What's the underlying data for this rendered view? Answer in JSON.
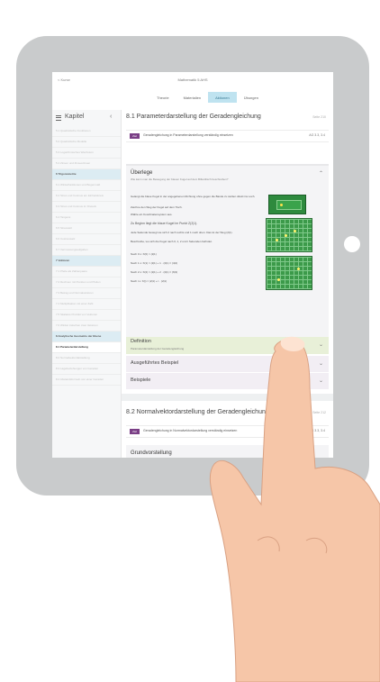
{
  "app": {
    "back_label": "< Kurse",
    "title": "Mathematik 5 AHS",
    "tabs": [
      "Theorie",
      "Materialien",
      "Aktionen",
      "Übungen"
    ],
    "active_tab": 2
  },
  "sidebar": {
    "title": "Kapitel",
    "collapse_glyph": "‹",
    "items": [
      {
        "label": "5.1 Quadratische Funktionen",
        "kind": "dim"
      },
      {
        "label": "5.2 Quadratische Modelle",
        "kind": "dim"
      },
      {
        "label": "5.3 Logarithmisches Wachstum",
        "kind": "dim"
      },
      {
        "label": "5.4 Zinsen und Zinseszinsen",
        "kind": "dim"
      },
      {
        "label": "6 Trigonometrie",
        "kind": "section"
      },
      {
        "label": "6.1 Winkelfunktionen und Bogenmaß",
        "kind": "dim"
      },
      {
        "label": "6.2 Sinus und Cosinus am Einheitskreis",
        "kind": "dim"
      },
      {
        "label": "6.3 Sinus und Cosinus im Dreieck",
        "kind": "dim"
      },
      {
        "label": "6.4 Tangens",
        "kind": "dim"
      },
      {
        "label": "6.5 Sinussatz",
        "kind": "dim"
      },
      {
        "label": "6.6 Cosinussatz",
        "kind": "dim"
      },
      {
        "label": "6.7 Vermessungsaufgaben",
        "kind": "dim"
      },
      {
        "label": "7 Vektoren",
        "kind": "section"
      },
      {
        "label": "7.1 Pfeile als Zahlenpaare",
        "kind": "dim"
      },
      {
        "label": "7.2 Rechnen mit Punkten und Pfeilen",
        "kind": "dim"
      },
      {
        "label": "7.3 Betrag und Normalvektoren",
        "kind": "dim"
      },
      {
        "label": "7.4 Multiplikation mit einer Zahl",
        "kind": "dim"
      },
      {
        "label": "7.5 Skalares Produkt von Vektoren",
        "kind": "dim"
      },
      {
        "label": "7.6 Winkel zwischen zwei Vektoren",
        "kind": "dim"
      },
      {
        "label": "8 Analytische Geometrie der Ebene",
        "kind": "section"
      },
      {
        "label": "8.1 Parameterdarstellung",
        "kind": "active"
      },
      {
        "label": "8.2 Normalvektordarstellung",
        "kind": "dim"
      },
      {
        "label": "8.3 Lagebeziehungen von Geraden",
        "kind": "dim"
      },
      {
        "label": "8.4 Abstandsformeln von einer Geraden",
        "kind": "dim"
      }
    ]
  },
  "main": {
    "section1": {
      "title": "8.1 Parameterdarstellung der Geradengleichung",
      "page": "Seite 210",
      "goal_badge": "Ziel",
      "goal_text": "Geradengleichung in Parameterdarstellung verständig einsetzen",
      "goal_code": "AG 3.3, 3.4"
    },
    "ueberlege": {
      "title": "Überlege",
      "subtitle": "Wie kann man die Bewegung der blauen Kugel auf dem Billardtisch beschreiben?",
      "lines": [
        "Gelangt die blaue Kugel in der angegebenen Richtung ohne gegen die Bande zu stoßen direkt ins Loch.",
        "Zeichne den Weg der Kugel auf dem Tisch.",
        "Wähle ein Koordinatensystem aus.",
        "Zu Beginn liegt die blaue Kugel im Punkt Z(2|1).",
        "Jede Sekunde bewegt sie sich 2 nach rechts und 1 nach oben. Das ist der Weg (2|1).",
        "Beschreibe, wo sich die Kugel nach 0, 1, 2 und t Sekunden befindet."
      ],
      "steps": [
        {
          "label": "Nach 0 s: X(0) =",
          "expr": "(2|1)"
        },
        {
          "label": "Nach 1 s: X(1) =",
          "expr": "(2|1) + 1 · (2|1) = (4|2)"
        },
        {
          "label": "Nach 2 s: X(2) =",
          "expr": "(2|1) + 2 · (2|1) = (6|3)"
        },
        {
          "label": "Nach t s: X(t) =",
          "expr": "(2|1) + t · (2|1)"
        }
      ]
    },
    "definition": {
      "title": "Definition",
      "subtitle": "Parameterdarstellung der Geradengleichung"
    },
    "beispiel": {
      "title": "Ausgeführtes Beispiel"
    },
    "beispiele": {
      "title": "Beispiele"
    },
    "section2": {
      "title": "8.2 Normalvektordarstellung der Geradengleichung",
      "page": "Seite 212",
      "goal_badge": "Ziel",
      "goal_text": "Geradengleichung in Normalvektordarstellung verständig einsetzen",
      "goal_code": "AG 3.3, 3.4"
    },
    "card2_title": "Grundvorstellung"
  },
  "icons": {
    "menu": "menu-icon",
    "chevron_up": "chevron-up-icon",
    "chevron_down": "chevron-down-icon"
  },
  "colors": {
    "accent_tab": "#bfe3f0",
    "badge": "#7a3f86",
    "definition_bg": "#e8f0d8"
  }
}
